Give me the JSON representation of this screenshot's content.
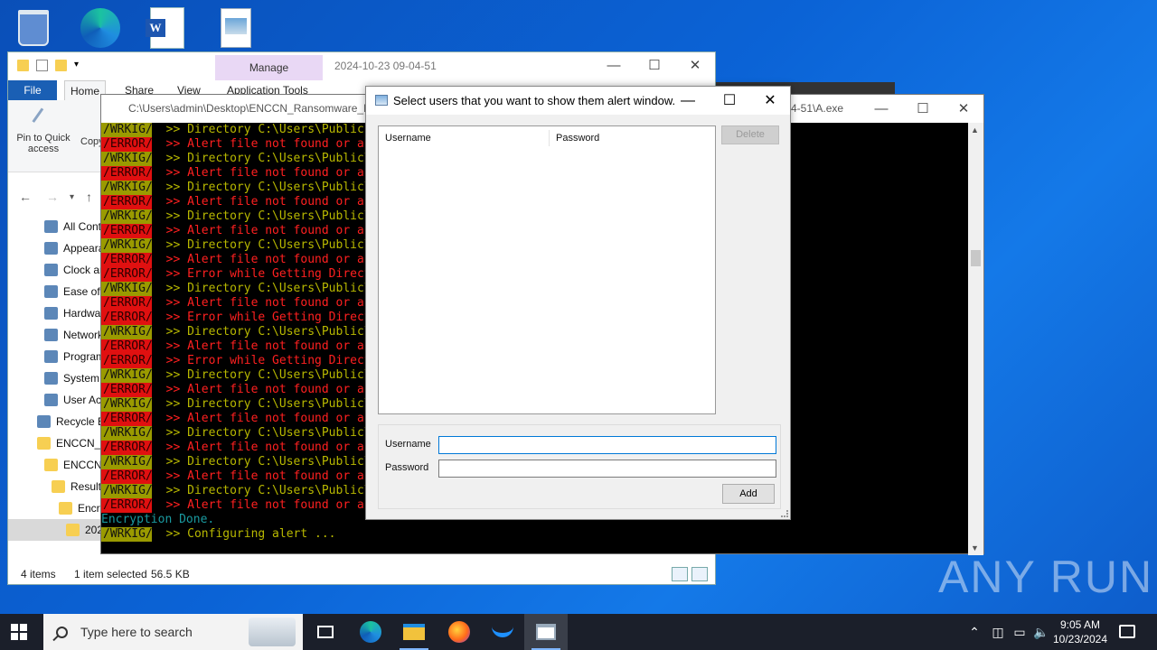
{
  "desktop": {
    "icons": [
      "recycle-bin",
      "microsoft-edge",
      "word-document",
      "image-file"
    ]
  },
  "explorer": {
    "manage_tab": "Manage",
    "title": "2024-10-23 09-04-51",
    "tabs": {
      "file": "File",
      "home": "Home",
      "share": "Share",
      "view": "View",
      "app_tools": "Application Tools"
    },
    "ribbon": {
      "pin": "Pin to Quick access",
      "copy": "Copy"
    },
    "tree": [
      "All Cont",
      "Appeara",
      "Clock ar",
      "Ease of A",
      "Hardwa",
      "Network",
      "Program",
      "System",
      "User Acc",
      "Recycle B",
      "ENCCN_R",
      "ENCCN",
      "Result",
      "Encry",
      "202"
    ],
    "status": {
      "items": "4 items",
      "selected": "1 item selected",
      "size": "56.5 KB"
    }
  },
  "console": {
    "title": "C:\\Users\\admin\\Desktop\\ENCCN_Ransomware_Bu",
    "title_right": "4-51\\A.exe",
    "tags": {
      "warn": "/WRKIG/",
      "error": "/ERROR/"
    },
    "lines": [
      {
        "type": "w",
        "text": ">> Directory C:\\Users\\Public"
      },
      {
        "type": "e",
        "text": ">> Alert file not found or ac"
      },
      {
        "type": "w",
        "text": ">> Directory C:\\Users\\Public\\"
      },
      {
        "type": "e",
        "text": ">> Alert file not found or ac"
      },
      {
        "type": "w",
        "text": ">> Directory C:\\Users\\Public\\"
      },
      {
        "type": "e",
        "text": ">> Alert file not found or ac"
      },
      {
        "type": "w",
        "text": ">> Directory C:\\Users\\Public\\"
      },
      {
        "type": "e",
        "text": ">> Alert file not found or ac"
      },
      {
        "type": "w",
        "text": ">> Directory C:\\Users\\Public\\"
      },
      {
        "type": "e",
        "text": ">> Alert file not found or ac"
      },
      {
        "type": "e",
        "text": ">> Error while Getting Direct"
      },
      {
        "type": "w",
        "text": ">> Directory C:\\Users\\Public\\"
      },
      {
        "type": "e",
        "text": ">> Alert file not found or ac"
      },
      {
        "type": "e",
        "text": ">> Error while Getting Direct"
      },
      {
        "type": "w",
        "text": ">> Directory C:\\Users\\Public\\"
      },
      {
        "type": "e",
        "text": ">> Alert file not found or ac"
      },
      {
        "type": "e",
        "text": ">> Error while Getting Direct"
      },
      {
        "type": "w",
        "text": ">> Directory C:\\Users\\Public\\"
      },
      {
        "type": "e",
        "text": ">> Alert file not found or ac"
      },
      {
        "type": "w",
        "text": ">> Directory C:\\Users\\Public\\"
      },
      {
        "type": "e",
        "text": ">> Alert file not found or ac"
      },
      {
        "type": "w",
        "text": ">> Directory C:\\Users\\Public\\"
      },
      {
        "type": "e",
        "text": ">> Alert file not found or ac"
      },
      {
        "type": "w",
        "text": ">> Directory C:\\Users\\Public\\"
      },
      {
        "type": "e",
        "text": ">> Alert file not found or ac"
      },
      {
        "type": "w",
        "text": ">> Directory C:\\Users\\Public\\"
      },
      {
        "type": "e",
        "text": ">> Alert file not found or ac"
      }
    ],
    "done_line": "Encryption Done.",
    "last_line": ">> Configuring alert ..."
  },
  "dialog": {
    "title": "Select users that you want to show them alert window.",
    "columns": [
      "Username",
      "Password"
    ],
    "delete_label": "Delete",
    "username_label": "Username",
    "password_label": "Password",
    "username_value": "",
    "password_value": "",
    "add_label": "Add"
  },
  "watermark": "ANY RUN",
  "taskbar": {
    "search_placeholder": "Type here to search",
    "time": "9:05 AM",
    "date": "10/23/2024"
  }
}
